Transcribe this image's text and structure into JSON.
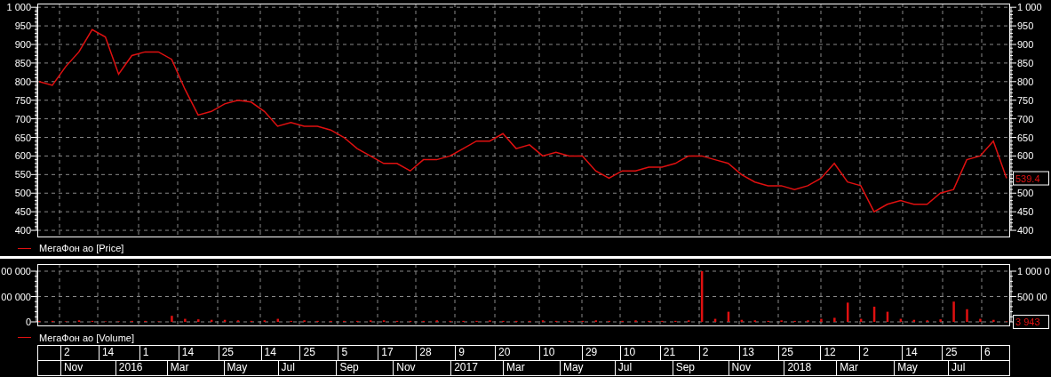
{
  "price_panel": {
    "chart_data": {
      "type": "line",
      "grid": true,
      "ylim": [
        381,
        1010
      ],
      "yticks": [
        {
          "value": 1000,
          "label": "1 000"
        },
        950,
        900,
        850,
        800,
        750,
        700,
        650,
        600,
        550,
        500,
        450,
        400
      ],
      "series": [
        {
          "name": "МегаФон ао [Price]",
          "color": "#e01010",
          "values": [
            800,
            790,
            840,
            880,
            940,
            920,
            820,
            870,
            880,
            880,
            860,
            780,
            710,
            720,
            740,
            750,
            745,
            720,
            680,
            690,
            680,
            680,
            670,
            650,
            620,
            600,
            580,
            580,
            560,
            590,
            590,
            600,
            620,
            640,
            640,
            660,
            620,
            630,
            600,
            610,
            600,
            600,
            560,
            540,
            560,
            560,
            570,
            570,
            580,
            600,
            600,
            590,
            580,
            550,
            530,
            520,
            520,
            510,
            520,
            540,
            580,
            530,
            520,
            450,
            470,
            480,
            470,
            470,
            500,
            510,
            590,
            600,
            640,
            540
          ]
        }
      ]
    },
    "right_labels": [
      "1 000",
      "950",
      "900",
      "850",
      "800",
      "750",
      "700",
      "650",
      "600",
      "500",
      "450",
      "400"
    ],
    "last_label": "539.4"
  },
  "volume_panel": {
    "legend": "МегаФон ао [Volume]",
    "left_labels": [
      "00 000",
      "00 000",
      "0"
    ],
    "right_labels": [
      "1 000 0",
      "500 00"
    ],
    "last_label": "3 943"
  },
  "timeline": {
    "days": [
      "2",
      "14",
      "1",
      "14",
      "25",
      "14",
      "25",
      "5",
      "17",
      "28",
      "9",
      "20",
      "10",
      "29",
      "10",
      "21",
      "2",
      "13",
      "25",
      "12",
      "2",
      "14",
      "25",
      "6"
    ],
    "months": [
      "Nov",
      "2016",
      "Mar",
      "May",
      "Jul",
      "Sep",
      "Nov",
      "2017",
      "Mar",
      "May",
      "Jul",
      "Sep",
      "Nov",
      "2018",
      "Mar",
      "May",
      "Jul"
    ]
  }
}
